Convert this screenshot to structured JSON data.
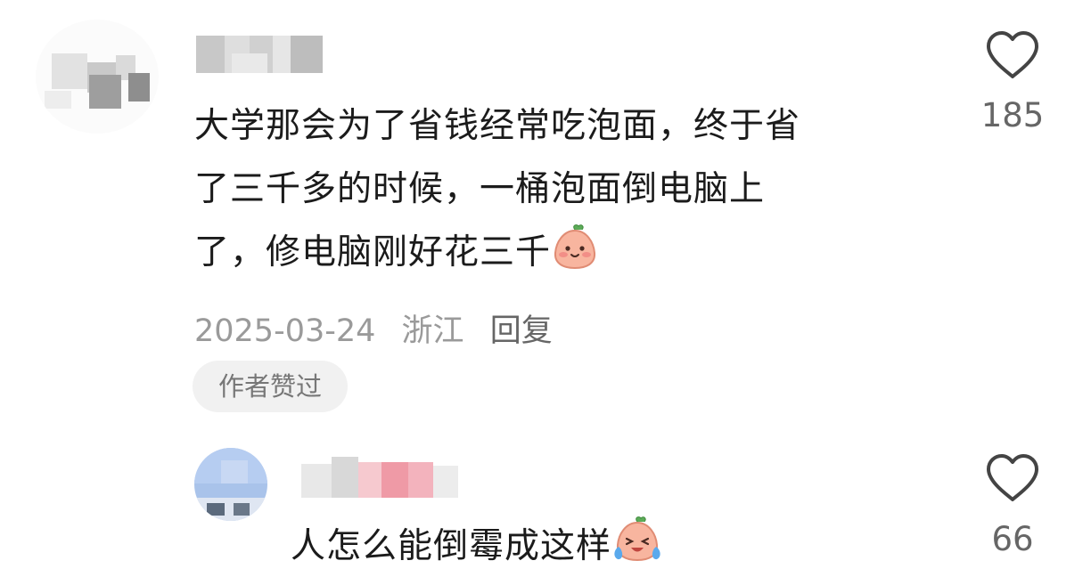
{
  "comment": {
    "text_lines": [
      "大学那会为了省钱经常吃泡面，终于省",
      "了三千多的时候，一桶泡面倒电脑上",
      "了，修电脑刚好花三千"
    ],
    "emoji": "blush-peach-emoji",
    "date": "2025-03-24",
    "location": "浙江",
    "reply_label": "回复",
    "badge": "作者赞过",
    "likes": "185"
  },
  "reply": {
    "text": "人怎么能倒霉成这样",
    "emoji": "crying-laughing-peach-emoji",
    "likes": "66"
  },
  "colors": {
    "text": "#1b1b1b",
    "meta": "#9a9a9a",
    "badge_bg": "#f1f1f1",
    "like_outline": "#444444"
  }
}
